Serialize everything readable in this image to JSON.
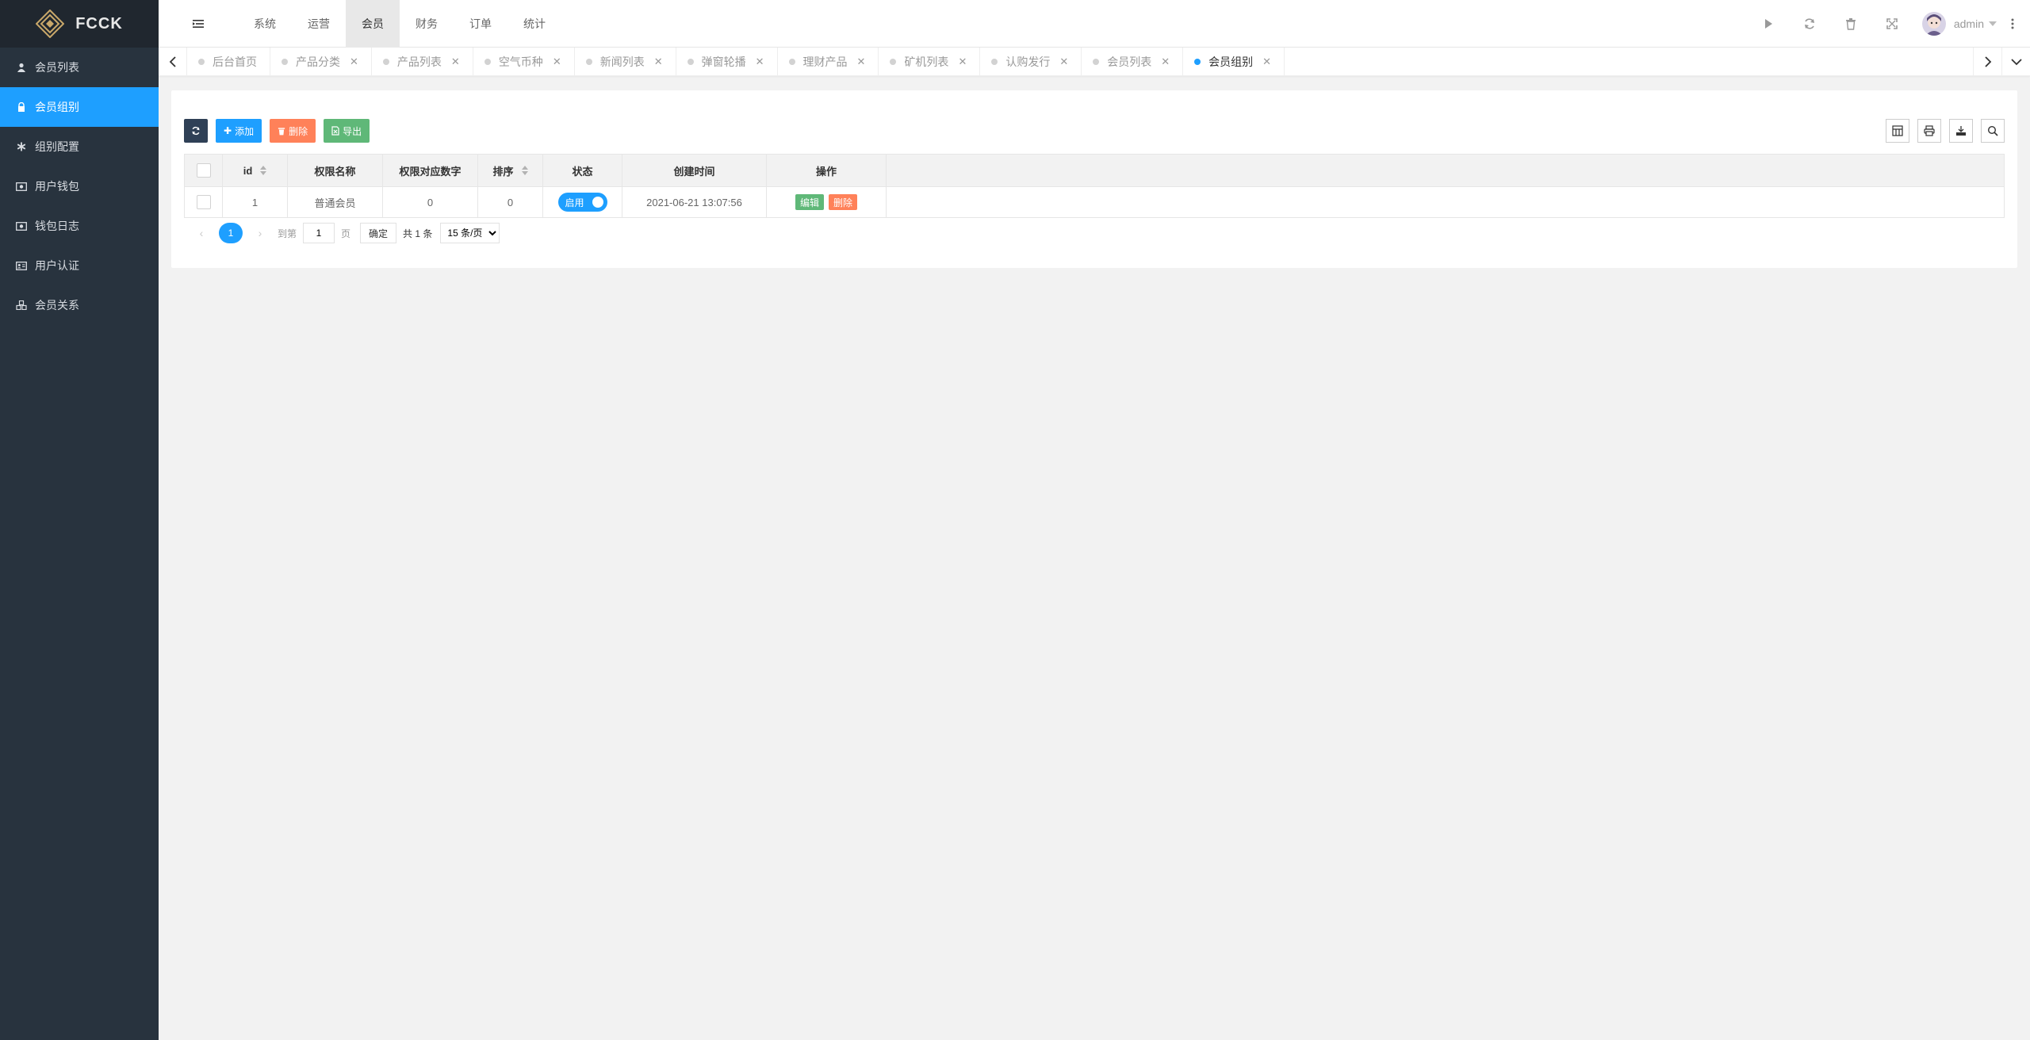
{
  "brand": {
    "name": "FCCK"
  },
  "sidebar": {
    "items": [
      {
        "label": "会员列表",
        "icon": "user-icon"
      },
      {
        "label": "会员组别",
        "icon": "lock-icon",
        "active": true
      },
      {
        "label": "组别配置",
        "icon": "asterisk-icon"
      },
      {
        "label": "用户钱包",
        "icon": "money-icon"
      },
      {
        "label": "钱包日志",
        "icon": "money-icon"
      },
      {
        "label": "用户认证",
        "icon": "id-card-icon"
      },
      {
        "label": "会员关系",
        "icon": "cubes-icon"
      }
    ]
  },
  "header": {
    "nav": [
      "系统",
      "运营",
      "会员",
      "财务",
      "订单",
      "统计"
    ],
    "active_nav": "会员",
    "user": "admin"
  },
  "tabs": [
    {
      "label": "后台首页",
      "closable": false
    },
    {
      "label": "产品分类",
      "closable": true
    },
    {
      "label": "产品列表",
      "closable": true
    },
    {
      "label": "空气币种",
      "closable": true
    },
    {
      "label": "新闻列表",
      "closable": true
    },
    {
      "label": "弹窗轮播",
      "closable": true
    },
    {
      "label": "理财产品",
      "closable": true
    },
    {
      "label": "矿机列表",
      "closable": true
    },
    {
      "label": "认购发行",
      "closable": true
    },
    {
      "label": "会员列表",
      "closable": true
    },
    {
      "label": "会员组别",
      "closable": true,
      "active": true
    }
  ],
  "toolbar": {
    "add": "添加",
    "delete": "删除",
    "export": "导出"
  },
  "table": {
    "columns": [
      "id",
      "权限名称",
      "权限对应数字",
      "排序",
      "状态",
      "创建时间",
      "操作"
    ],
    "rows": [
      {
        "id": "1",
        "name": "普通会员",
        "num": "0",
        "sort": "0",
        "status": "启用",
        "time": "2021-06-21 13:07:56",
        "edit": "编辑",
        "del": "删除"
      }
    ]
  },
  "pager": {
    "current": "1",
    "goto_label": "到第",
    "goto_value": "1",
    "page_unit": "页",
    "confirm": "确定",
    "total": "共 1 条",
    "page_size": "15 条/页"
  },
  "colors": {
    "accent": "#1e9fff",
    "sidebar": "#28333e",
    "success": "#5fb878",
    "danger": "#ff5722"
  }
}
